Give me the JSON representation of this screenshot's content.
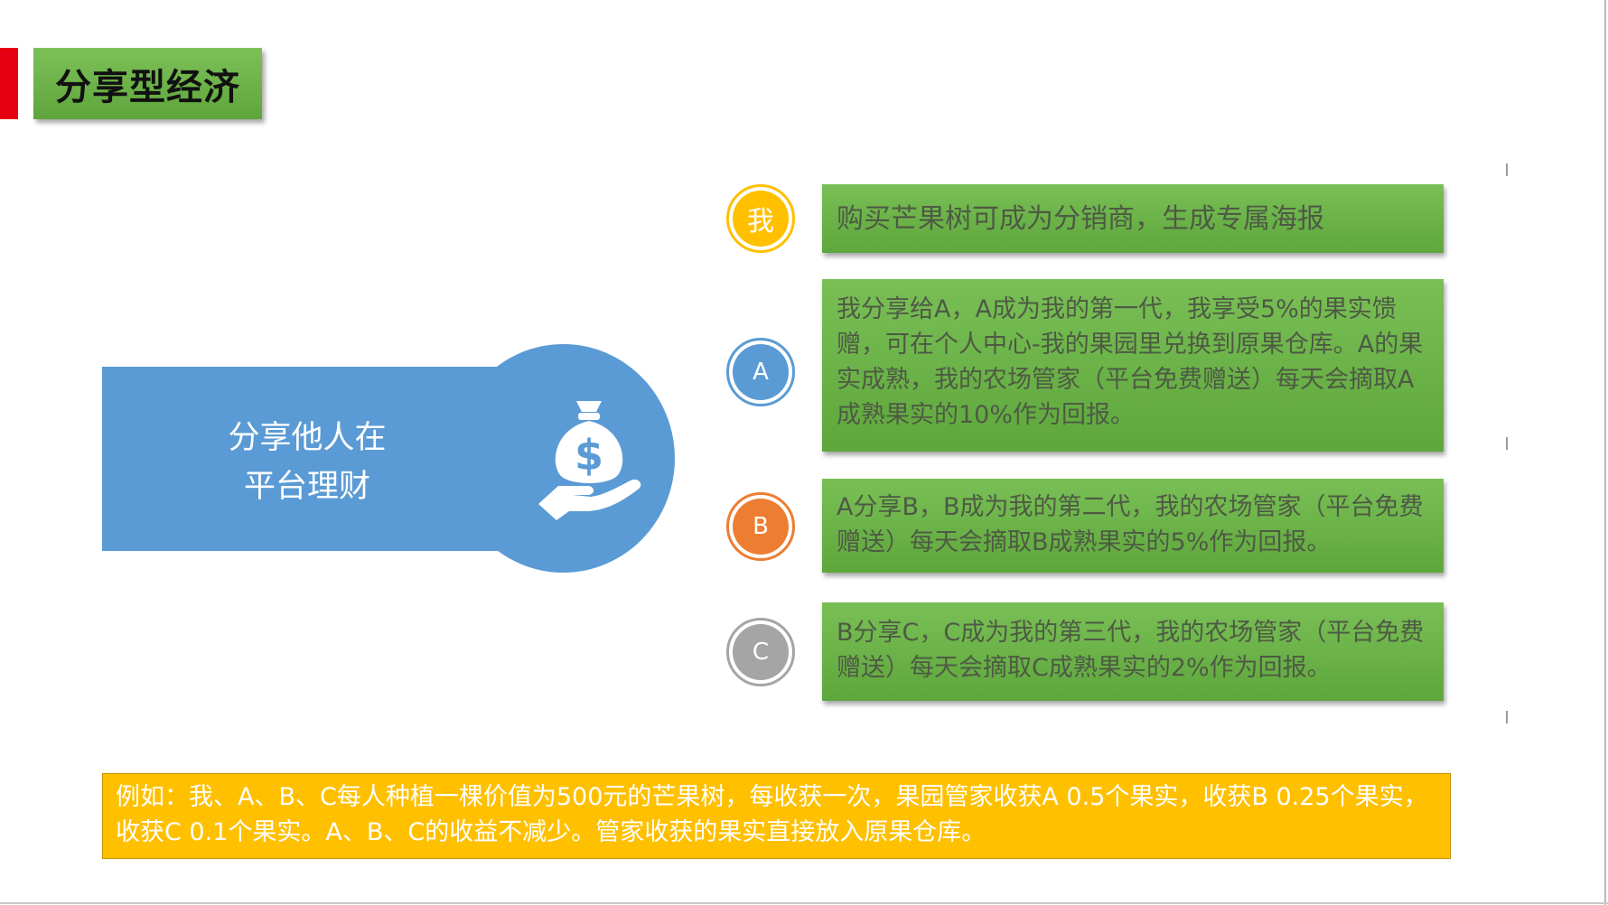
{
  "header": {
    "title": "分享型经济"
  },
  "left_panel": {
    "text_line1": "分享他人在",
    "text_line2": "平台理财",
    "icon": "money-bag-hand-icon"
  },
  "items": [
    {
      "badge": "我",
      "badge_color": "#ffc000",
      "text": "购买芒果树可成为分销商，生成专属海报"
    },
    {
      "badge": "A",
      "badge_color": "#5b9bd5",
      "text": "我分享给A，A成为我的第一代，我享受5%的果实馈赠，可在个人中心-我的果园里兑换到原果仓库。A的果实成熟，我的农场管家（平台免费赠送）每天会摘取A成熟果实的10%作为回报。"
    },
    {
      "badge": "B",
      "badge_color": "#ed7d31",
      "text": "A分享B，B成为我的第二代，我的农场管家（平台免费赠送）每天会摘取B成熟果实的5%作为回报。"
    },
    {
      "badge": "C",
      "badge_color": "#a5a5a5",
      "text": "B分享C，C成为我的第三代，我的农场管家（平台免费赠送）每天会摘取C成熟果实的2%作为回报。"
    }
  ],
  "example": {
    "text": "例如：我、A、B、C每人种植一棵价值为500元的芒果树，每收获一次，果园管家收获A 0.5个果实，收获B 0.25个果实，收获C 0.1个果实。A、B、C的收益不减少。管家收获的果实直接放入原果仓库。"
  },
  "colors": {
    "accent_red": "#e60012",
    "green": "#70ad47",
    "blue": "#5b9bd5",
    "yellow": "#ffc000",
    "orange": "#ed7d31",
    "gray": "#a5a5a5"
  }
}
